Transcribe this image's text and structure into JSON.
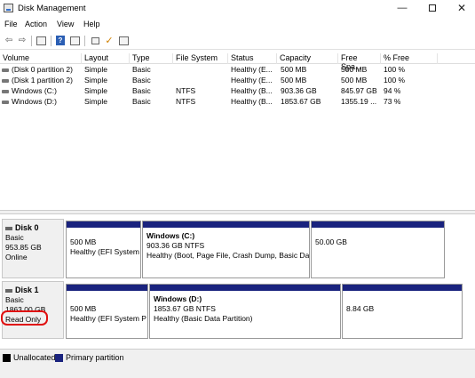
{
  "window": {
    "title": "Disk Management",
    "minimize": "—",
    "close": "✕"
  },
  "menu": [
    "File",
    "Action",
    "View",
    "Help"
  ],
  "toolbar": {
    "back": "⇦",
    "forward": "⇨",
    "help": "?"
  },
  "volumes": {
    "headers": [
      "Volume",
      "Layout",
      "Type",
      "File System",
      "Status",
      "Capacity",
      "Free Spa...",
      "% Free"
    ],
    "rows": [
      [
        "(Disk 0 partition 2)",
        "Simple",
        "Basic",
        "",
        "Healthy (E...",
        "500 MB",
        "500 MB",
        "100 %"
      ],
      [
        "(Disk 1 partition 2)",
        "Simple",
        "Basic",
        "",
        "Healthy (E...",
        "500 MB",
        "500 MB",
        "100 %"
      ],
      [
        "Windows (C:)",
        "Simple",
        "Basic",
        "NTFS",
        "Healthy (B...",
        "903.36 GB",
        "845.97 GB",
        "94 %"
      ],
      [
        "Windows (D:)",
        "Simple",
        "Basic",
        "NTFS",
        "Healthy (B...",
        "1853.67 GB",
        "1355.19 ...",
        "73 %"
      ]
    ]
  },
  "disks": [
    {
      "name": "Disk 0",
      "type": "Basic",
      "size": "953.85 GB",
      "state": "Online",
      "partitions": [
        {
          "title": "",
          "line1": "500 MB",
          "line2": "Healthy (EFI System"
        },
        {
          "title": "Windows  (C:)",
          "line1": "903.36 GB NTFS",
          "line2": "Healthy (Boot, Page File, Crash Dump, Basic Da"
        },
        {
          "title": "",
          "line1": "50.00 GB",
          "line2": ""
        }
      ]
    },
    {
      "name": "Disk 1",
      "type": "Basic",
      "size": "1863.00 GB",
      "state": "Read Only",
      "partitions": [
        {
          "title": "",
          "line1": "500 MB",
          "line2": "Healthy (EFI System P"
        },
        {
          "title": "Windows  (D:)",
          "line1": "1853.67 GB NTFS",
          "line2": "Healthy (Basic Data Partition)"
        },
        {
          "title": "",
          "line1": "8.84 GB",
          "line2": ""
        }
      ]
    }
  ],
  "legend": [
    {
      "label": "Unallocated",
      "color": "#000000"
    },
    {
      "label": "Primary partition",
      "color": "#1a237e"
    }
  ]
}
